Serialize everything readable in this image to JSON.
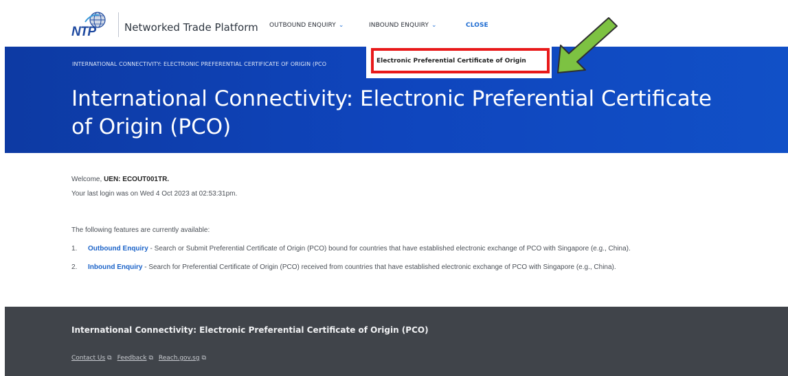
{
  "header": {
    "logo_mark": "NTP",
    "logo_text": "Networked Trade Platform",
    "nav": {
      "outbound": "OUTBOUND ENQUIRY",
      "inbound": "INBOUND ENQUIRY",
      "close": "CLOSE"
    }
  },
  "hero": {
    "breadcrumb": "INTERNATIONAL CONNECTIVITY: ELECTRONIC PREFERENTIAL CERTIFICATE OF ORIGIN (PCO",
    "title": "International Connectivity: Electronic Preferential Certificate of Origin (PCO)"
  },
  "dropdown": {
    "item": "Electronic Preferential Certificate of Origin"
  },
  "main": {
    "welcome_prefix": "Welcome, ",
    "welcome_uen": "UEN: ECOUT001TR.",
    "last_login": "Your last login was on Wed 4 Oct 2023 at 02:53:31pm.",
    "features_intro": "The following features are currently available:",
    "features": [
      {
        "num": "1.",
        "link": "Outbound Enquiry",
        "desc": " - Search or Submit Preferential Certificate of Origin (PCO) bound for countries that have established electronic exchange of PCO with Singapore (e.g., China)."
      },
      {
        "num": "2.",
        "link": "Inbound Enquiry",
        "desc": " - Search for Preferential Certificate of Origin (PCO) received from countries that have established electronic exchange of PCO with Singapore (e.g., China)."
      }
    ]
  },
  "footer": {
    "title": "International Connectivity: Electronic Preferential Certificate of Origin (PCO)",
    "links": [
      "Contact Us",
      "Feedback",
      "Reach.gov.sg"
    ]
  },
  "icons": {
    "chevron": "chevron-down-icon",
    "external": "external-link-icon",
    "annotation": "arrow-annotation-icon"
  },
  "colors": {
    "brand_blue": "#0f45bd",
    "link_blue": "#1a62c8",
    "highlight_red": "#e8191a",
    "arrow_green": "#7dc242",
    "footer_bg": "#40444a"
  }
}
